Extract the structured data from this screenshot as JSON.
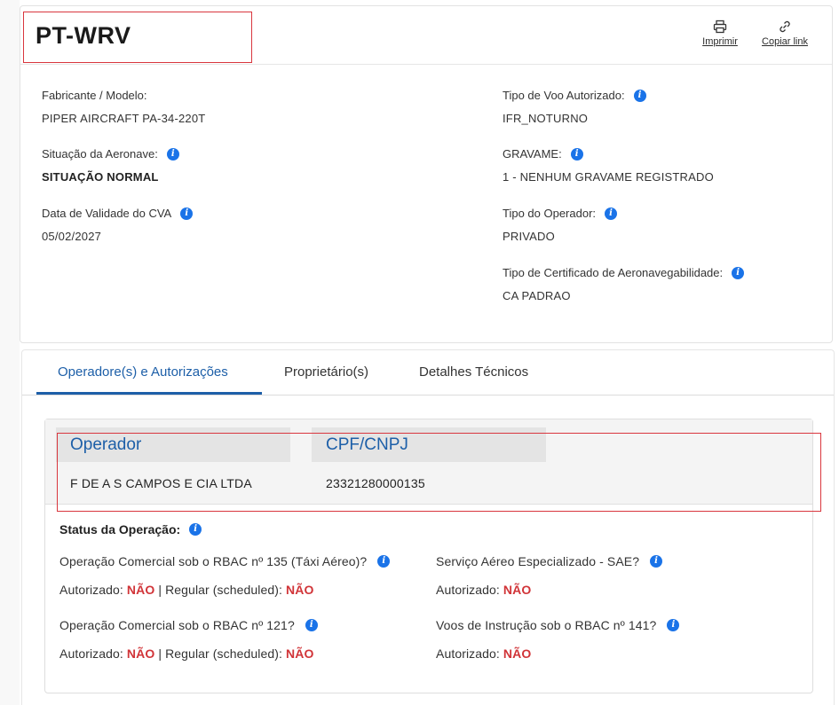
{
  "aircraft": {
    "registration": "PT-WRV"
  },
  "header_actions": {
    "print_label": "Imprimir",
    "copy_label": "Copiar link"
  },
  "fields": {
    "fabricante_label": "Fabricante / Modelo:",
    "fabricante_value": "PIPER AIRCRAFT PA-34-220T",
    "situacao_label": "Situação da Aeronave:",
    "situacao_value": "SITUAÇÃO NORMAL",
    "cva_label": "Data de Validade do CVA",
    "cva_value": "05/02/2027",
    "tipo_voo_label": "Tipo de Voo Autorizado:",
    "tipo_voo_value": "IFR_NOTURNO",
    "gravame_label": "GRAVAME:",
    "gravame_value": "1 - NENHUM GRAVAME REGISTRADO",
    "tipo_operador_label": "Tipo do Operador:",
    "tipo_operador_value": "PRIVADO",
    "certificado_label": "Tipo de Certificado de Aeronavegabilidade:",
    "certificado_value": "CA PADRAO"
  },
  "tabs": [
    {
      "label": "Operadore(s) e Autorizações",
      "active": true
    },
    {
      "label": "Proprietário(s)",
      "active": false
    },
    {
      "label": "Detalhes Técnicos",
      "active": false
    }
  ],
  "operator_table": {
    "headers": [
      "Operador",
      "CPF/CNPJ"
    ],
    "rows": [
      [
        "F DE A S CAMPOS E CIA LTDA",
        "23321280000135"
      ]
    ]
  },
  "status": {
    "title": "Status da Operação:",
    "authorized_label": "Autorizado:",
    "regular_label": "| Regular (scheduled):",
    "no_value": "NÃO",
    "rbac135_question": "Operação Comercial sob o RBAC nº 135 (Táxi Aéreo)?",
    "rbac121_question": "Operação Comercial sob o RBAC nº 121?",
    "sae_question": "Serviço Aéreo Especializado - SAE?",
    "rbac141_question": "Voos de Instrução sob o RBAC nº 141?"
  },
  "icons": {
    "info": "i",
    "accent_color": "#1d5fa8",
    "info_color": "#1a73e8",
    "negative_color": "#d13438"
  }
}
